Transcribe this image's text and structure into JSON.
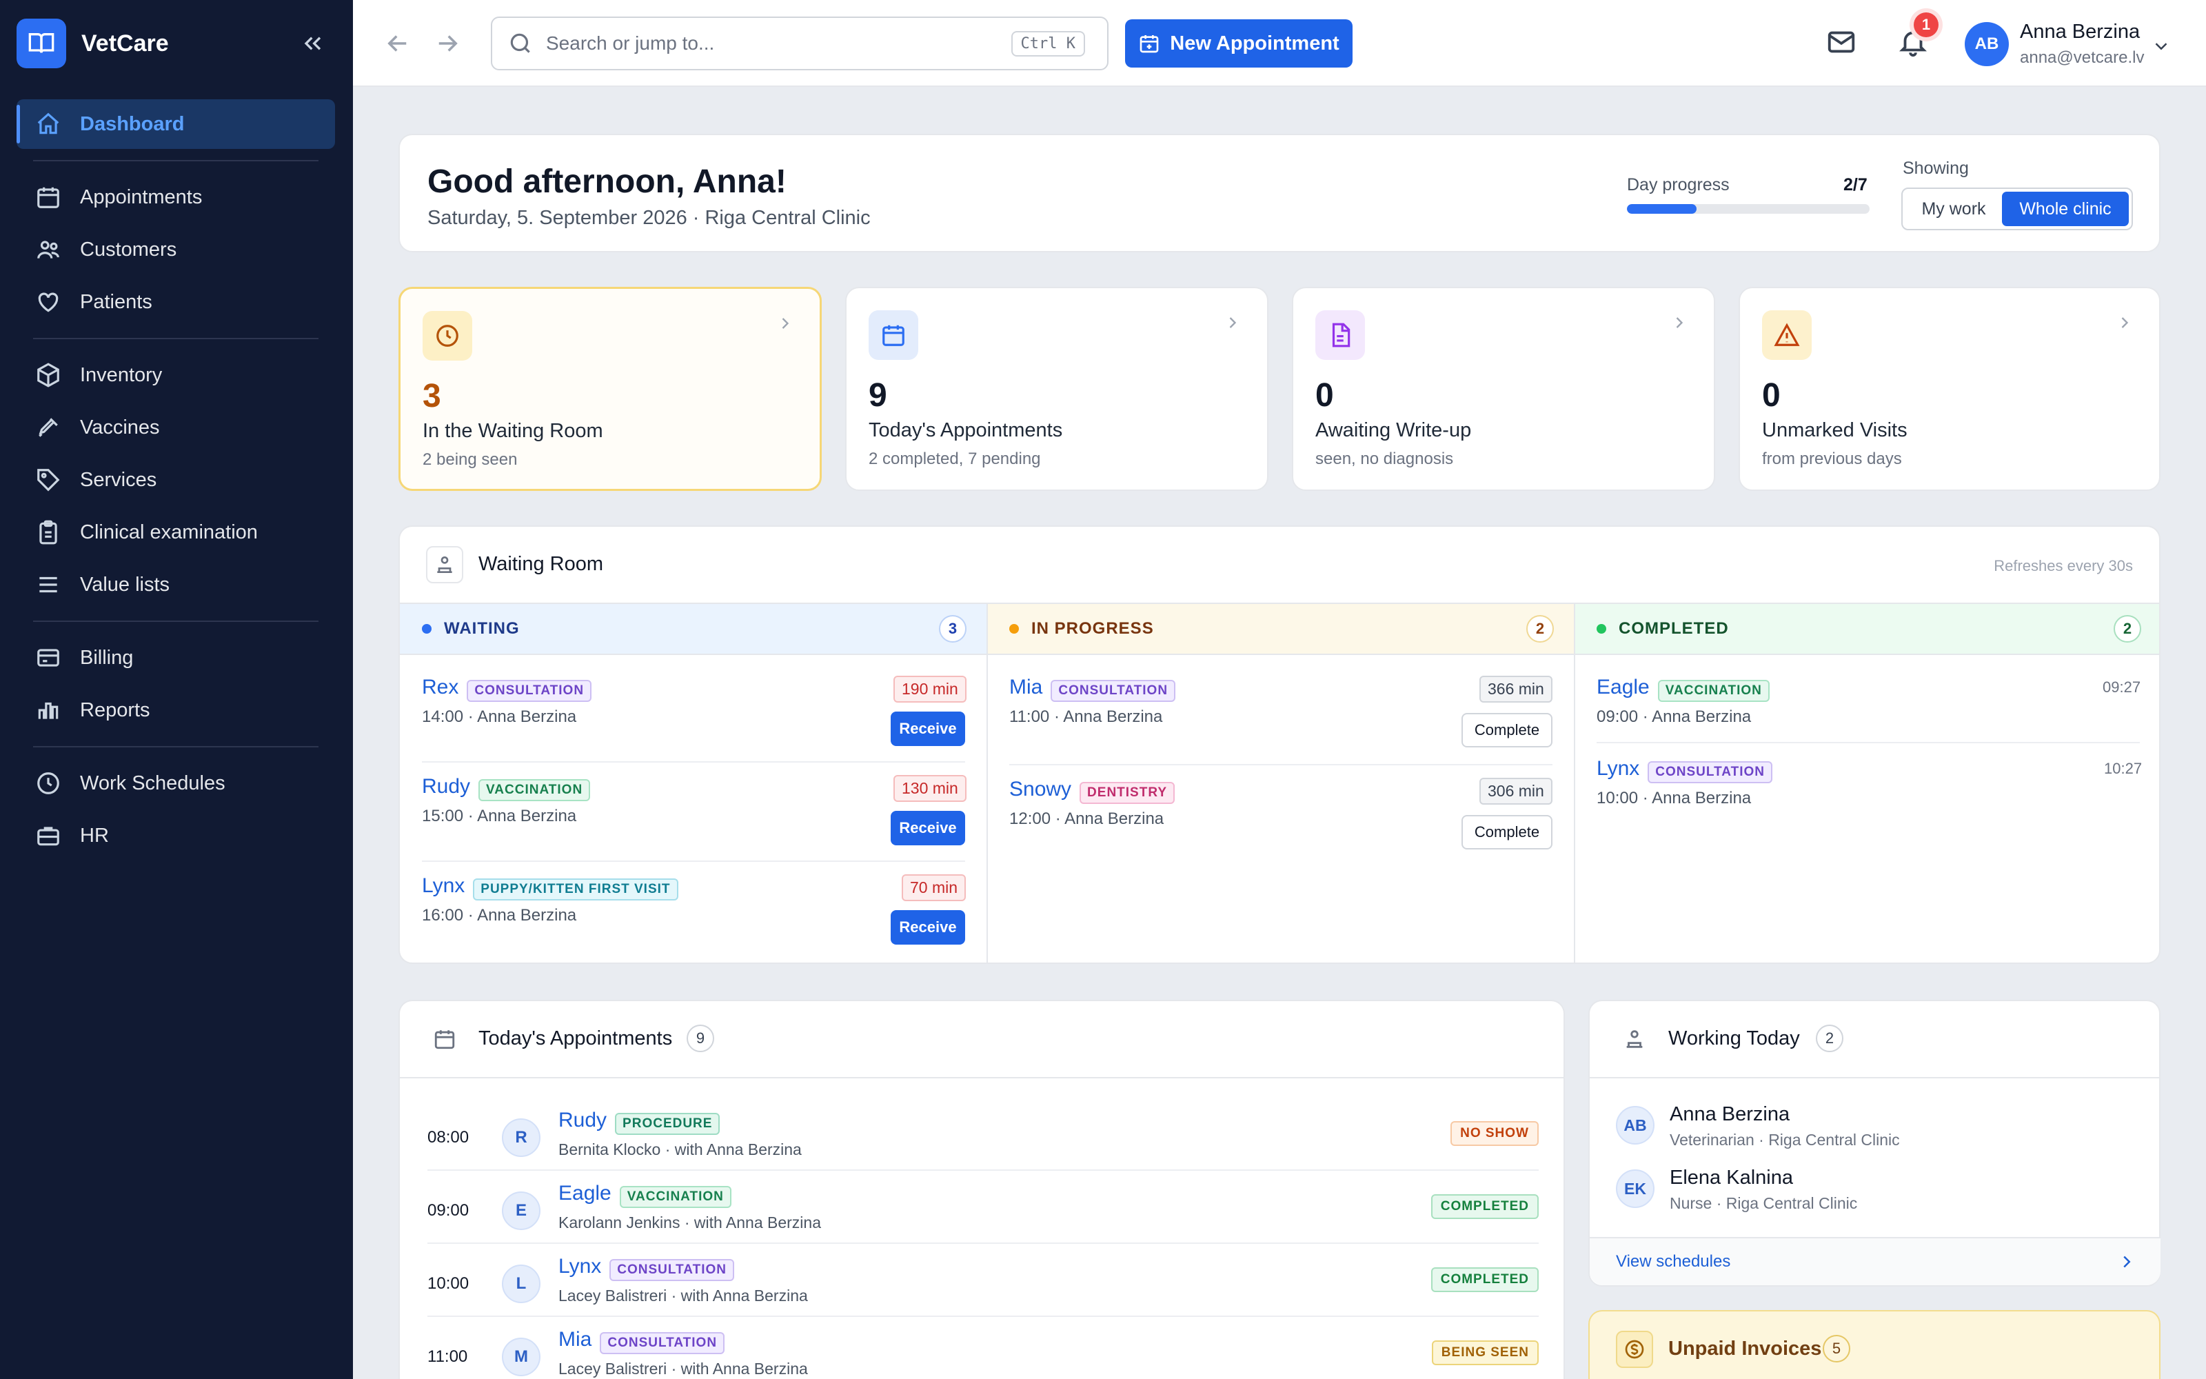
{
  "app": {
    "name": "VetCare"
  },
  "sidebar": {
    "items": [
      {
        "label": "Dashboard"
      },
      {
        "label": "Appointments"
      },
      {
        "label": "Customers"
      },
      {
        "label": "Patients"
      },
      {
        "label": "Inventory"
      },
      {
        "label": "Vaccines"
      },
      {
        "label": "Services"
      },
      {
        "label": "Clinical examination"
      },
      {
        "label": "Value lists"
      },
      {
        "label": "Billing"
      },
      {
        "label": "Reports"
      },
      {
        "label": "Work Schedules"
      },
      {
        "label": "HR"
      }
    ]
  },
  "topbar": {
    "search_placeholder": "Search or jump to...",
    "shortcut": "Ctrl K",
    "new_appointment": "New Appointment",
    "notifications_count": "1",
    "user": {
      "initials": "AB",
      "name": "Anna Berzina",
      "email": "anna@vetcare.lv"
    }
  },
  "greeting": {
    "title": "Good afternoon, Anna!",
    "subtitle": "Saturday, 5. September 2026 · Riga Central Clinic",
    "day_progress_label": "Day progress",
    "day_progress_value": "2/7",
    "day_progress_fraction": 0.2857,
    "showing_label": "Showing",
    "toggle_my_work": "My work",
    "toggle_whole_clinic": "Whole clinic"
  },
  "stats": [
    {
      "value": "3",
      "label": "In the Waiting Room",
      "sub": "2 being seen"
    },
    {
      "value": "9",
      "label": "Today's Appointments",
      "sub": "2 completed, 7 pending"
    },
    {
      "value": "0",
      "label": "Awaiting Write-up",
      "sub": "seen, no diagnosis"
    },
    {
      "value": "0",
      "label": "Unmarked Visits",
      "sub": "from previous days"
    }
  ],
  "waiting_room": {
    "title": "Waiting Room",
    "refresh": "Refreshes every 30s",
    "columns": {
      "waiting": {
        "title": "WAITING",
        "count": "3",
        "items": [
          {
            "pet": "Rex",
            "tag": "CONSULTATION",
            "meta": "14:00 · Anna Berzina",
            "minutes": "190 min",
            "action": "Receive"
          },
          {
            "pet": "Rudy",
            "tag": "VACCINATION",
            "meta": "15:00 · Anna Berzina",
            "minutes": "130 min",
            "action": "Receive"
          },
          {
            "pet": "Lynx",
            "tag": "PUPPY/KITTEN FIRST VISIT",
            "meta": "16:00 · Anna Berzina",
            "minutes": "70 min",
            "action": "Receive"
          }
        ]
      },
      "in_progress": {
        "title": "IN PROGRESS",
        "count": "2",
        "items": [
          {
            "pet": "Mia",
            "tag": "CONSULTATION",
            "meta": "11:00 · Anna Berzina",
            "minutes": "366 min",
            "action": "Complete"
          },
          {
            "pet": "Snowy",
            "tag": "DENTISTRY",
            "meta": "12:00 · Anna Berzina",
            "minutes": "306 min",
            "action": "Complete"
          }
        ]
      },
      "completed": {
        "title": "COMPLETED",
        "count": "2",
        "items": [
          {
            "pet": "Eagle",
            "tag": "VACCINATION",
            "meta": "09:00 · Anna Berzina",
            "time": "09:27"
          },
          {
            "pet": "Lynx",
            "tag": "CONSULTATION",
            "meta": "10:00 · Anna Berzina",
            "time": "10:27"
          }
        ]
      }
    }
  },
  "appointments": {
    "title": "Today's Appointments",
    "count": "9",
    "rows": [
      {
        "time": "08:00",
        "initial": "R",
        "pet": "Rudy",
        "tag": "PROCEDURE",
        "owner": "Bernita Klocko · with Anna Berzina",
        "status": "NO SHOW"
      },
      {
        "time": "09:00",
        "initial": "E",
        "pet": "Eagle",
        "tag": "VACCINATION",
        "owner": "Karolann Jenkins · with Anna Berzina",
        "status": "COMPLETED"
      },
      {
        "time": "10:00",
        "initial": "L",
        "pet": "Lynx",
        "tag": "CONSULTATION",
        "owner": "Lacey Balistreri · with Anna Berzina",
        "status": "COMPLETED"
      },
      {
        "time": "11:00",
        "initial": "M",
        "pet": "Mia",
        "tag": "CONSULTATION",
        "owner": "Lacey Balistreri · with Anna Berzina",
        "status": "BEING SEEN"
      }
    ]
  },
  "working_today": {
    "title": "Working Today",
    "count": "2",
    "staff": [
      {
        "initials": "AB",
        "name": "Anna Berzina",
        "role": "Veterinarian · Riga Central Clinic"
      },
      {
        "initials": "EK",
        "name": "Elena Kalnina",
        "role": "Nurse · Riga Central Clinic"
      }
    ],
    "view_schedules": "View schedules"
  },
  "unpaid": {
    "title": "Unpaid Invoices",
    "count": "5"
  }
}
